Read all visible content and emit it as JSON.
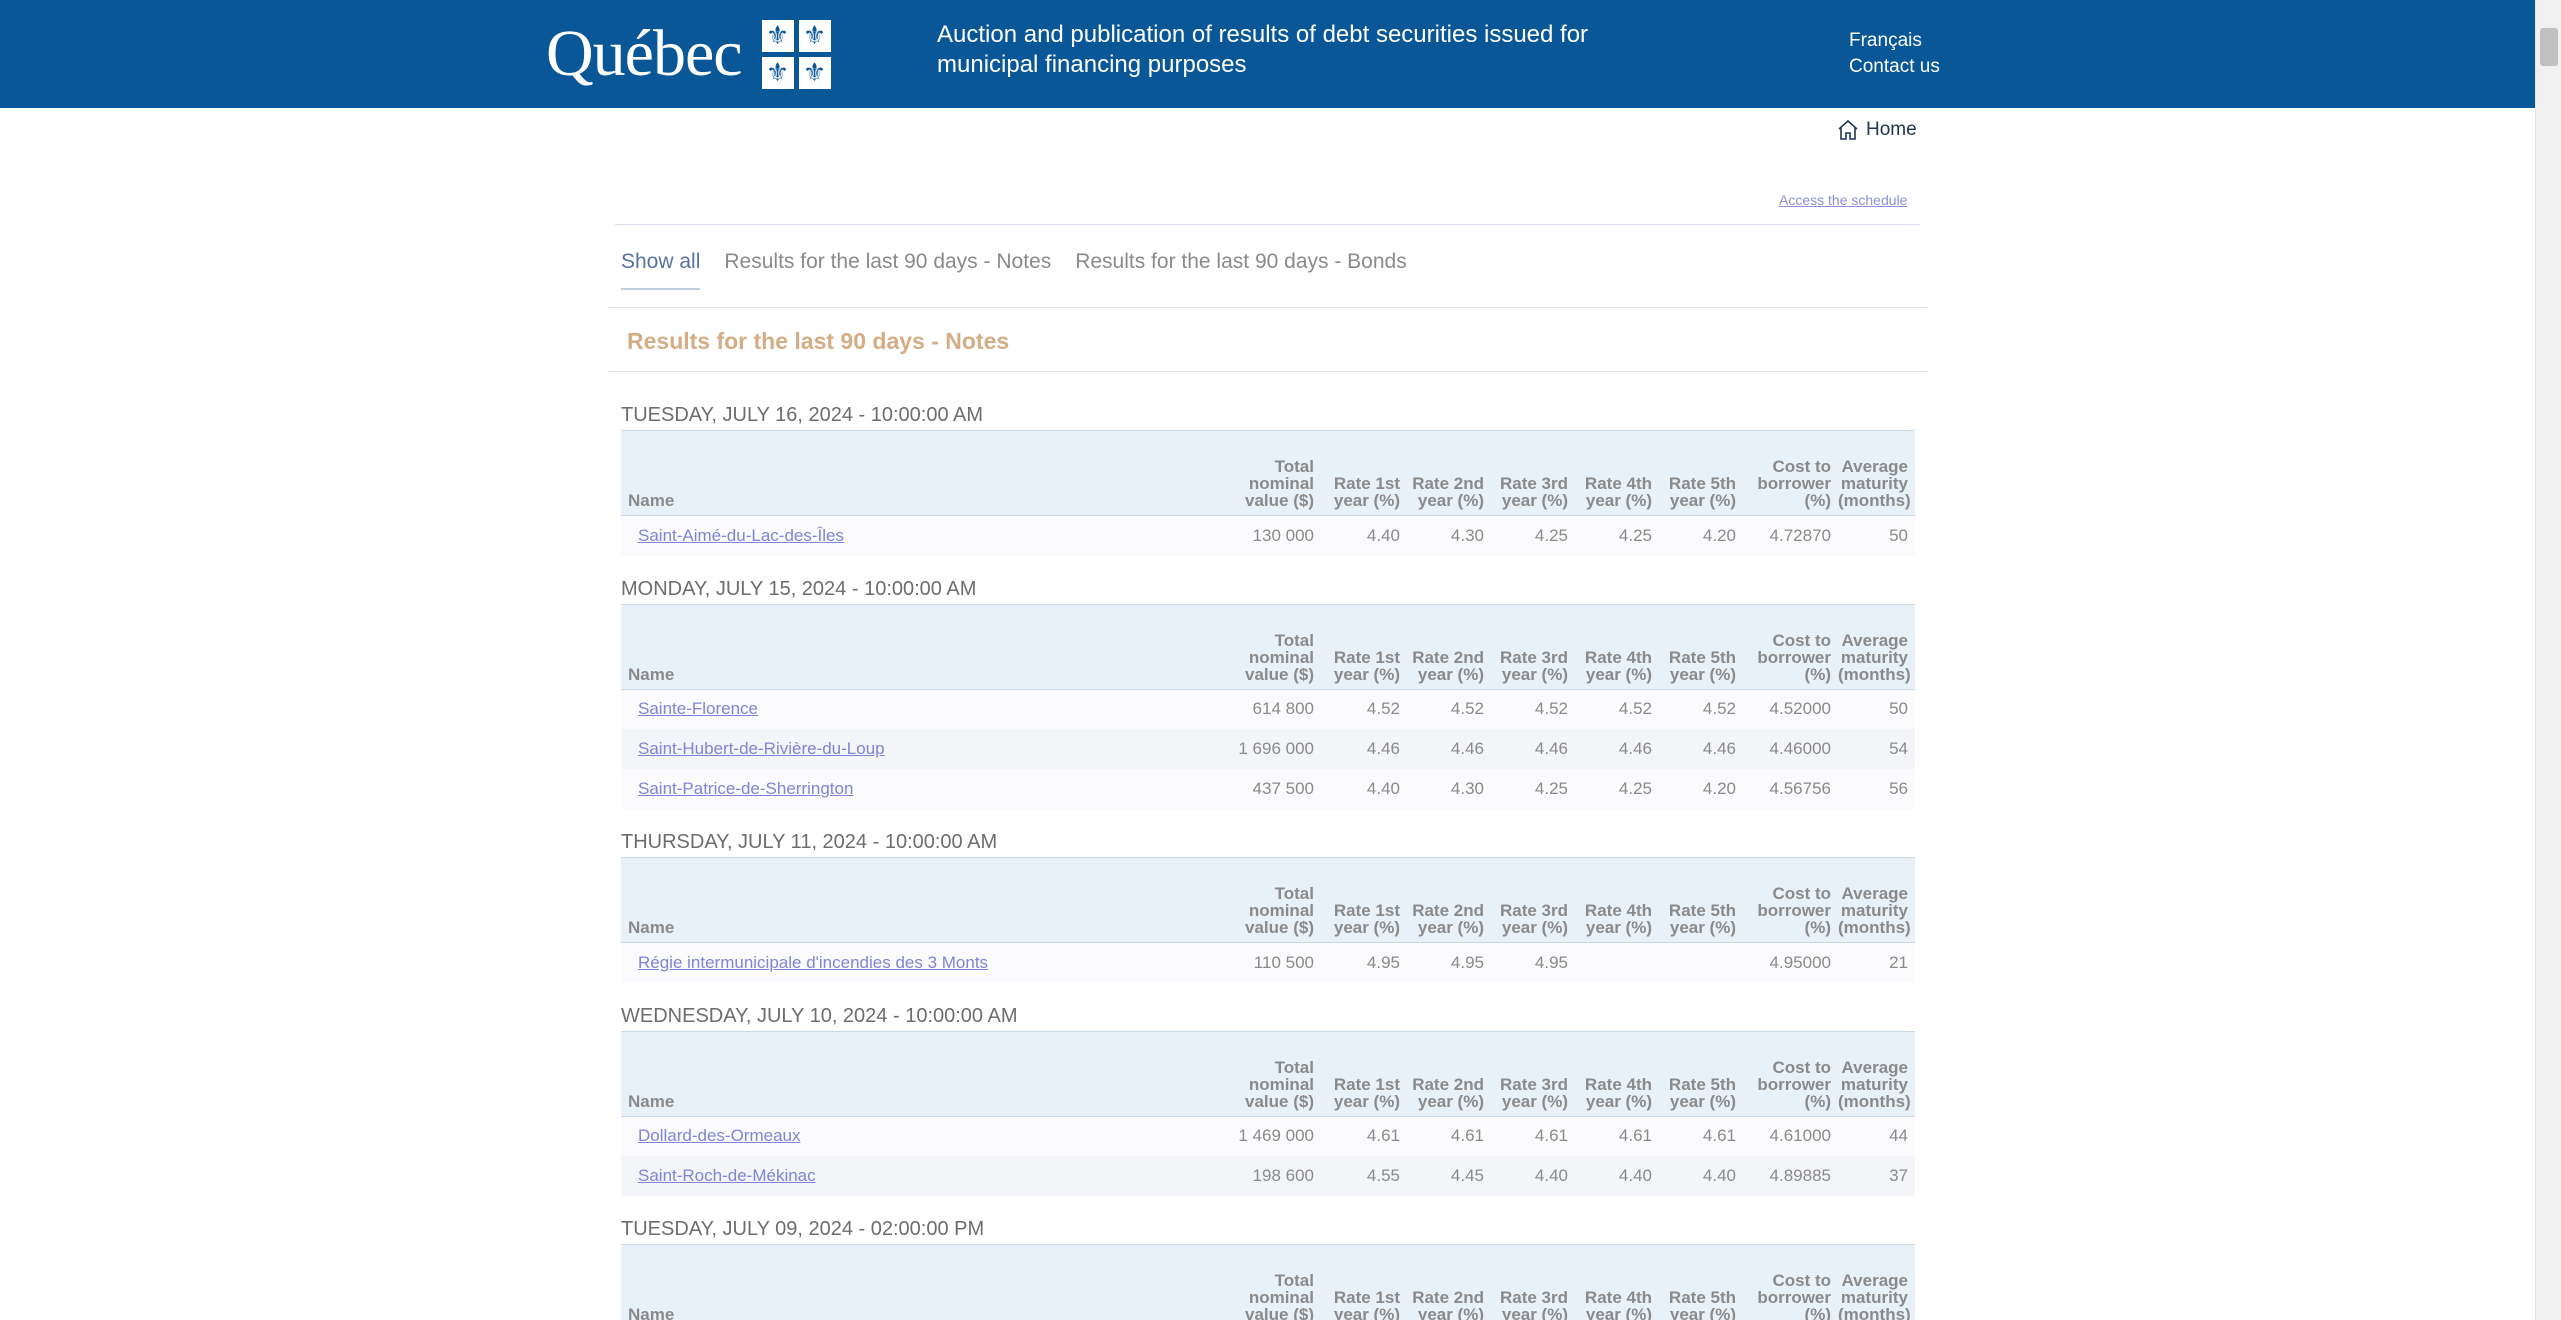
{
  "header": {
    "logo_text": "Québec",
    "flag_glyph": "⚜",
    "title": "Auction and publication of results of debt securities issued for municipal financing purposes",
    "lang_link": "Français",
    "contact_link": "Contact us"
  },
  "breadcrumb": {
    "icon": "home-icon",
    "home_label": "Home"
  },
  "schedule_link": "Access the schedule",
  "tabs": [
    {
      "label": "Show all",
      "active": true
    },
    {
      "label": "Results for the last 90 days - Notes",
      "active": false
    },
    {
      "label": "Results for the last 90 days - Bonds",
      "active": false
    }
  ],
  "section_title": "Results for the last 90 days - Notes",
  "columns": {
    "name": "Name",
    "total": "Total nominal value ($)",
    "rate1": "Rate 1st year (%)",
    "rate2": "Rate 2nd year (%)",
    "rate3": "Rate 3rd year (%)",
    "rate4": "Rate 4th year (%)",
    "rate5": "Rate 5th year (%)",
    "cost": "Cost to borrower (%)",
    "maturity": "Average maturity (months)"
  },
  "groups": [
    {
      "date": "TUESDAY, JULY 16, 2024 - 10:00:00 AM",
      "rows": [
        [
          "Saint-Aimé-du-Lac-des-Îles",
          "130 000",
          "4.40",
          "4.30",
          "4.25",
          "4.25",
          "4.20",
          "4.72870",
          "50"
        ]
      ]
    },
    {
      "date": "MONDAY, JULY 15, 2024 - 10:00:00 AM",
      "rows": [
        [
          "Sainte-Florence",
          "614 800",
          "4.52",
          "4.52",
          "4.52",
          "4.52",
          "4.52",
          "4.52000",
          "50"
        ],
        [
          "Saint-Hubert-de-Rivière-du-Loup",
          "1 696 000",
          "4.46",
          "4.46",
          "4.46",
          "4.46",
          "4.46",
          "4.46000",
          "54"
        ],
        [
          "Saint-Patrice-de-Sherrington",
          "437 500",
          "4.40",
          "4.30",
          "4.25",
          "4.25",
          "4.20",
          "4.56756",
          "56"
        ]
      ]
    },
    {
      "date": "THURSDAY, JULY 11, 2024 - 10:00:00 AM",
      "rows": [
        [
          "Régie intermunicipale d'incendies des 3 Monts",
          "110 500",
          "4.95",
          "4.95",
          "4.95",
          "",
          "",
          "4.95000",
          "21"
        ]
      ]
    },
    {
      "date": "WEDNESDAY, JULY 10, 2024 - 10:00:00 AM",
      "rows": [
        [
          "Dollard-des-Ormeaux",
          "1 469 000",
          "4.61",
          "4.61",
          "4.61",
          "4.61",
          "4.61",
          "4.61000",
          "44"
        ],
        [
          "Saint-Roch-de-Mékinac",
          "198 600",
          "4.55",
          "4.45",
          "4.40",
          "4.40",
          "4.40",
          "4.89885",
          "37"
        ]
      ]
    },
    {
      "date": "TUESDAY, JULY 09, 2024 - 02:00:00 PM",
      "rows": []
    }
  ]
}
